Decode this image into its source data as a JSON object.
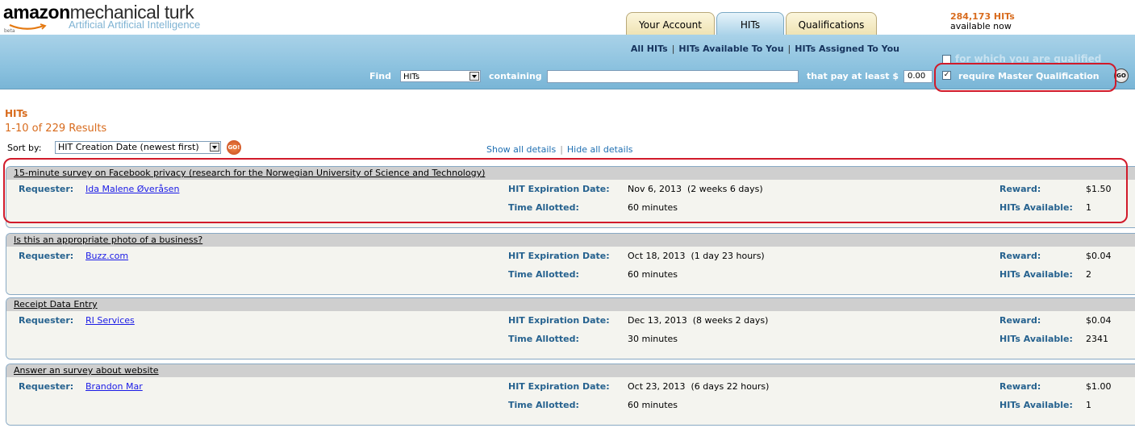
{
  "header": {
    "logo_main": "amazon",
    "logo_rest": "mechanical turk",
    "logo_tagline": "Artificial Artificial Intelligence",
    "logo_beta": "beta",
    "tabs": [
      {
        "label": "Your Account"
      },
      {
        "label": "HITs"
      },
      {
        "label": "Qualifications"
      }
    ],
    "hit_count": "284,173 HITs",
    "hit_count_sub": "available now"
  },
  "subnav": {
    "all_hits": "All HITs",
    "available": "HITs Available To You",
    "assigned": "HITs Assigned To You"
  },
  "search": {
    "find_label": "Find",
    "find_value": "HITs",
    "containing_label": "containing",
    "keyword_value": "",
    "pay_label": "that pay at least $",
    "min_pay": "0.00",
    "qualified_label": "for which you are qualified",
    "master_label": "require Master Qualification",
    "master_checked": "✓",
    "go_label": "GO"
  },
  "results": {
    "title": "HITs",
    "summary": "1-10 of 229 Results",
    "sort_label": "Sort by:",
    "sort_value": "HIT Creation Date (newest first)",
    "sort_go": "GO!",
    "show_all": "Show all details",
    "hide_all": "Hide all details"
  },
  "labels": {
    "requester": "Requester:",
    "expiration": "HIT Expiration Date:",
    "time_allotted": "Time Allotted:",
    "reward": "Reward:",
    "hits_available": "HITs Available:"
  },
  "hits": [
    {
      "title": "15-minute survey on Facebook privacy (research for the Norwegian University of Science and Technology)",
      "requester": "Ida Malene Øveråsen",
      "expiration": "Nov 6, 2013  (2 weeks 6 days)",
      "time_allotted": "60 minutes",
      "reward": "$1.50",
      "hits_available": "1"
    },
    {
      "title": "Is this an appropriate photo of a business?",
      "requester": "Buzz.com",
      "expiration": "Oct 18, 2013  (1 day 23 hours)",
      "time_allotted": "60 minutes",
      "reward": "$0.04",
      "hits_available": "2"
    },
    {
      "title": "Receipt Data Entry",
      "requester": "RI Services",
      "expiration": "Dec 13, 2013  (8 weeks 2 days)",
      "time_allotted": "30 minutes",
      "reward": "$0.04",
      "hits_available": "2341"
    },
    {
      "title": "Answer an survey about website",
      "requester": "Brandon Mar",
      "expiration": "Oct 23, 2013  (6 days 22 hours)",
      "time_allotted": "60 minutes",
      "reward": "$1.00",
      "hits_available": "1"
    }
  ]
}
